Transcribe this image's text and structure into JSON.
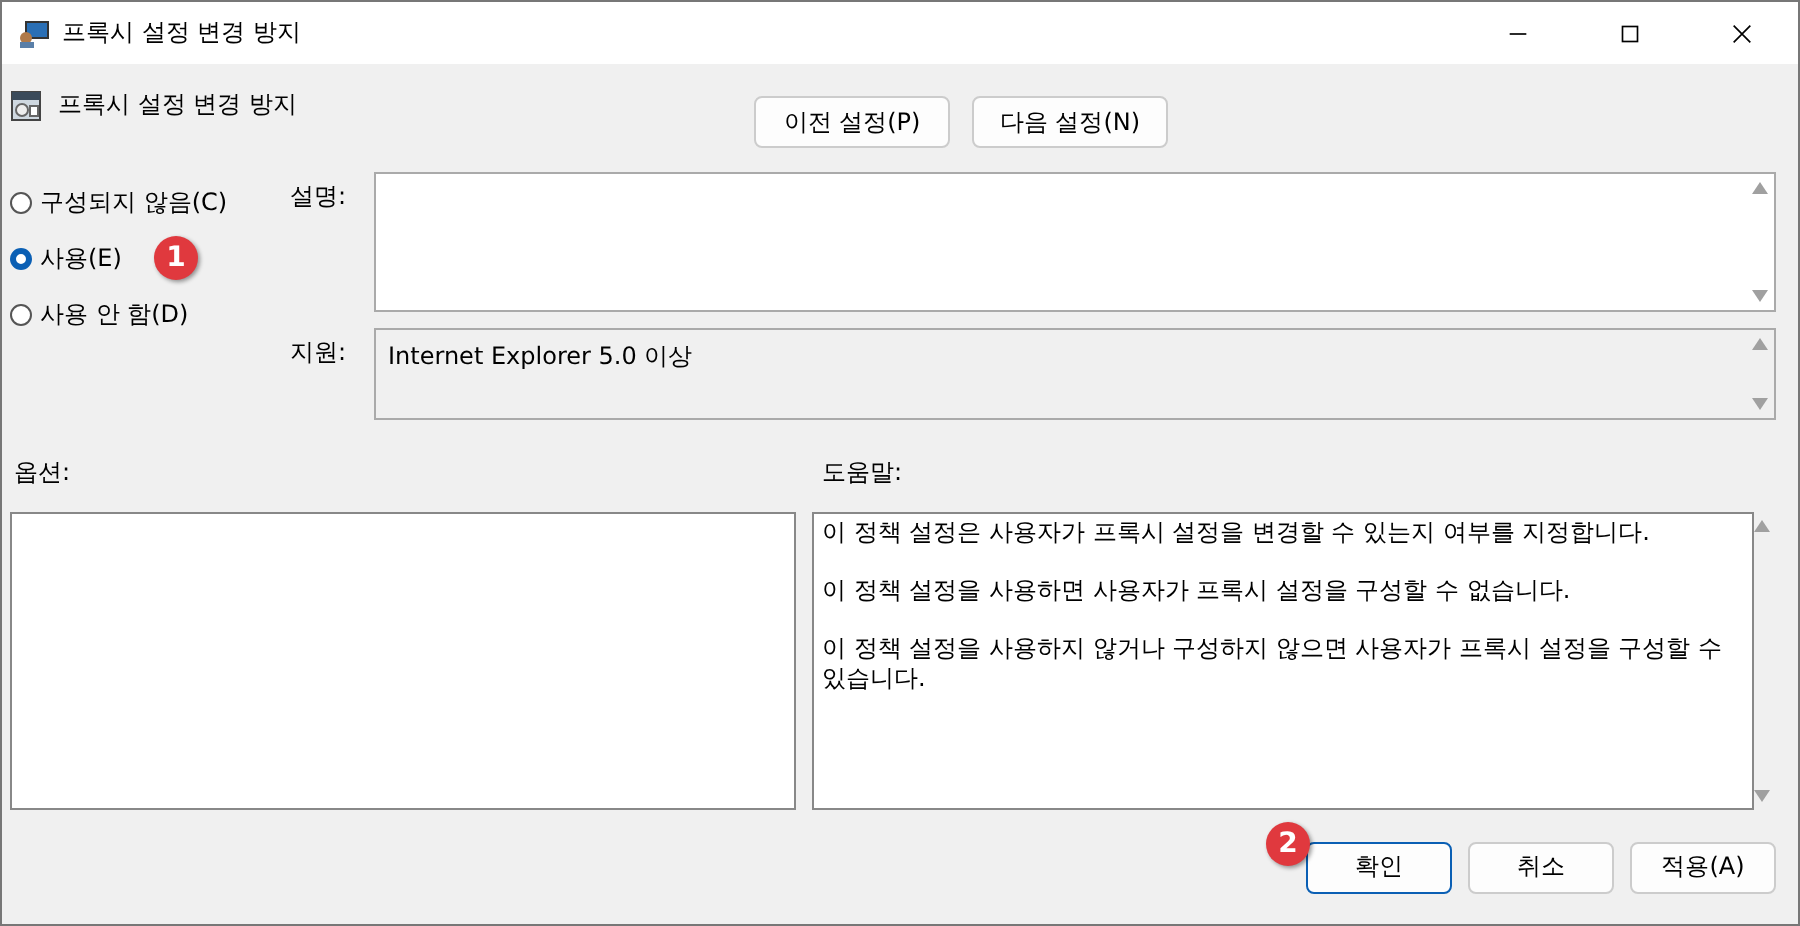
{
  "window": {
    "title": "프록시 설정 변경 방지"
  },
  "header": {
    "title": "프록시 설정 변경 방지",
    "buttons": [
      "이전 설정(P)",
      "다음 설정(N)"
    ]
  },
  "states": [
    {
      "label": "구성되지 않음(C)",
      "selected": false
    },
    {
      "label": "사용(E)",
      "selected": true
    },
    {
      "label": "사용 안 함(D)",
      "selected": false
    }
  ],
  "comment": {
    "label": "설명:"
  },
  "supported": {
    "label": "지원:",
    "value": "Internet Explorer 5.0 이상"
  },
  "options": {
    "label": "옵션:"
  },
  "help": {
    "label": "도움말:",
    "paragraphs": [
      "이 정책 설정은 사용자가 프록시 설정을 변경할 수 있는지 여부를 지정합니다.",
      "이 정책 설정을 사용하면 사용자가 프록시 설정을 구성할 수 없습니다.",
      "이 정책 설정을 사용하지 않거나 구성하지 않으면 사용자가 프록시 설정을 구성할 수 있습니다."
    ]
  },
  "footer": {
    "buttons": [
      {
        "label": "확인",
        "default": true
      },
      {
        "label": "취소",
        "default": false
      },
      {
        "label": "적용(A)",
        "default": false
      }
    ]
  },
  "annotations": [
    "1",
    "2"
  ]
}
